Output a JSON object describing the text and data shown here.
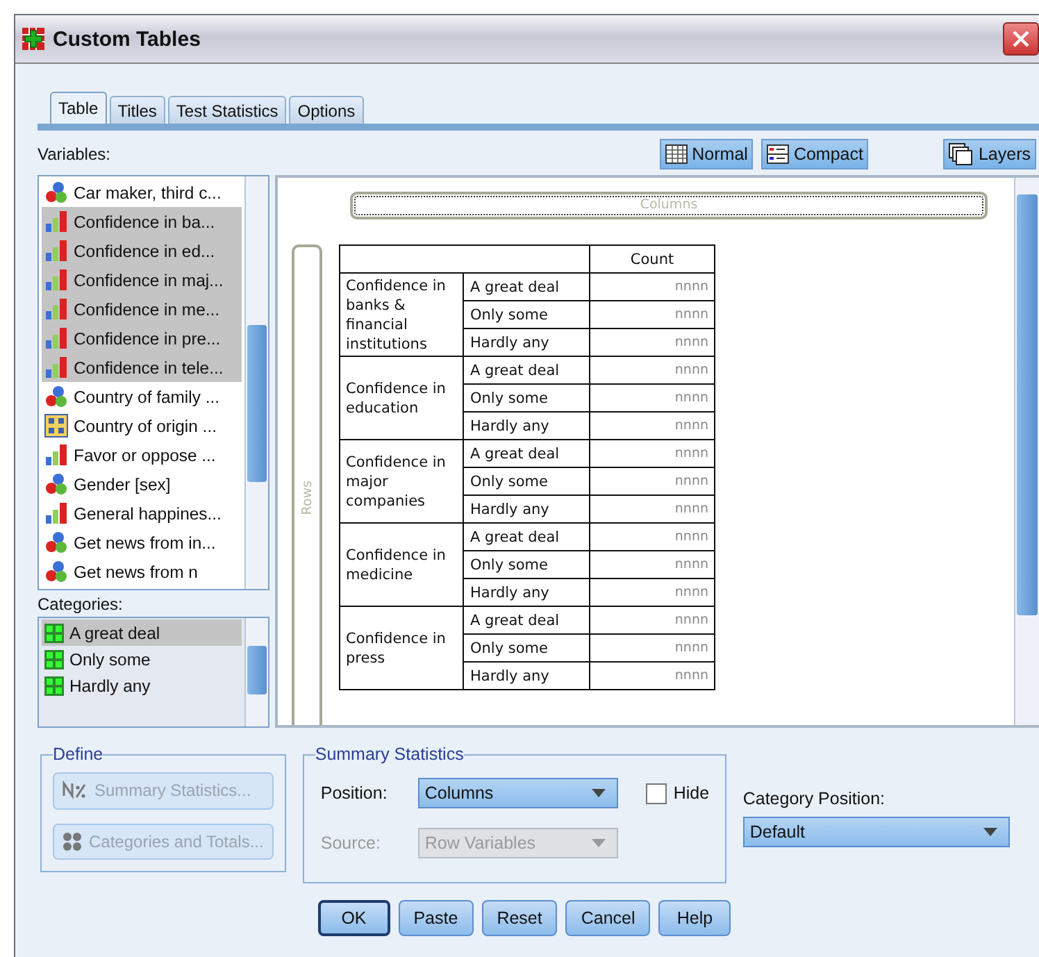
{
  "window": {
    "title": "Custom Tables"
  },
  "tabs": [
    {
      "label": "Table",
      "selected": true
    },
    {
      "label": "Titles",
      "selected": false
    },
    {
      "label": "Test Statistics",
      "selected": false
    },
    {
      "label": "Options",
      "selected": false
    }
  ],
  "variables": {
    "label": "Variables:",
    "items": [
      {
        "label": "Car maker, third c...",
        "kind": "nominal",
        "selected": false
      },
      {
        "label": "Confidence in ba...",
        "kind": "ordinal",
        "selected": true
      },
      {
        "label": "Confidence in ed...",
        "kind": "ordinal",
        "selected": true
      },
      {
        "label": "Confidence in maj...",
        "kind": "ordinal",
        "selected": true
      },
      {
        "label": "Confidence in me...",
        "kind": "ordinal",
        "selected": true
      },
      {
        "label": "Confidence in pre...",
        "kind": "ordinal",
        "selected": true
      },
      {
        "label": "Confidence in tele...",
        "kind": "ordinal",
        "selected": true
      },
      {
        "label": "Country of family ...",
        "kind": "nominal",
        "selected": false
      },
      {
        "label": "Country of origin ...",
        "kind": "set",
        "selected": false
      },
      {
        "label": "Favor or oppose ...",
        "kind": "ordinal",
        "selected": false
      },
      {
        "label": "Gender [sex]",
        "kind": "nominal",
        "selected": false
      },
      {
        "label": "General happines...",
        "kind": "ordinal",
        "selected": false
      },
      {
        "label": "Get news from in...",
        "kind": "nominal",
        "selected": false
      },
      {
        "label": "Get news from n",
        "kind": "nominal",
        "selected": false
      }
    ]
  },
  "view_buttons": [
    {
      "label": "Normal",
      "kind": "normal"
    },
    {
      "label": "Compact",
      "kind": "compact"
    }
  ],
  "layers_button": {
    "label": "Layers"
  },
  "categories": {
    "label": "Categories:",
    "items": [
      {
        "label": "A great deal",
        "selected": true
      },
      {
        "label": "Only some",
        "selected": false
      },
      {
        "label": "Hardly any",
        "selected": false
      }
    ]
  },
  "canvas": {
    "columns_label": "Columns",
    "rows_label": "Rows",
    "header": "Count",
    "groups": [
      {
        "label": "Confidence in banks & financial institutions",
        "rows": [
          {
            "category": "A great deal",
            "value": "nnnn"
          },
          {
            "category": "Only some",
            "value": "nnnn"
          },
          {
            "category": "Hardly any",
            "value": "nnnn"
          }
        ]
      },
      {
        "label": "Confidence in education",
        "rows": [
          {
            "category": "A great deal",
            "value": "nnnn"
          },
          {
            "category": "Only some",
            "value": "nnnn"
          },
          {
            "category": "Hardly any",
            "value": "nnnn"
          }
        ]
      },
      {
        "label": "Confidence in major companies",
        "rows": [
          {
            "category": "A great deal",
            "value": "nnnn"
          },
          {
            "category": "Only some",
            "value": "nnnn"
          },
          {
            "category": "Hardly any",
            "value": "nnnn"
          }
        ]
      },
      {
        "label": "Confidence in medicine",
        "rows": [
          {
            "category": "A great deal",
            "value": "nnnn"
          },
          {
            "category": "Only some",
            "value": "nnnn"
          },
          {
            "category": "Hardly any",
            "value": "nnnn"
          }
        ]
      },
      {
        "label": "Confidence in press",
        "rows": [
          {
            "category": "A great deal",
            "value": "nnnn"
          },
          {
            "category": "Only some",
            "value": "nnnn"
          },
          {
            "category": "Hardly any",
            "value": "nnnn"
          }
        ]
      }
    ]
  },
  "define": {
    "title": "Define",
    "buttons": [
      {
        "label": "Summary Statistics...",
        "kind": "stats",
        "disabled": true
      },
      {
        "label": "Categories and Totals...",
        "kind": "categories",
        "disabled": true
      }
    ]
  },
  "summary_statistics": {
    "title": "Summary Statistics",
    "position": {
      "label": "Position:",
      "value": "Columns"
    },
    "hide": {
      "label": "Hide",
      "checked": false
    },
    "source": {
      "label": "Source:",
      "value": "Row Variables",
      "disabled": true
    }
  },
  "category_position": {
    "label": "Category Position:",
    "value": "Default"
  },
  "buttons": [
    {
      "label": "OK",
      "default": true
    },
    {
      "label": "Paste",
      "default": false
    },
    {
      "label": "Reset",
      "default": false
    },
    {
      "label": "Cancel",
      "default": false
    },
    {
      "label": "Help",
      "default": false
    }
  ]
}
